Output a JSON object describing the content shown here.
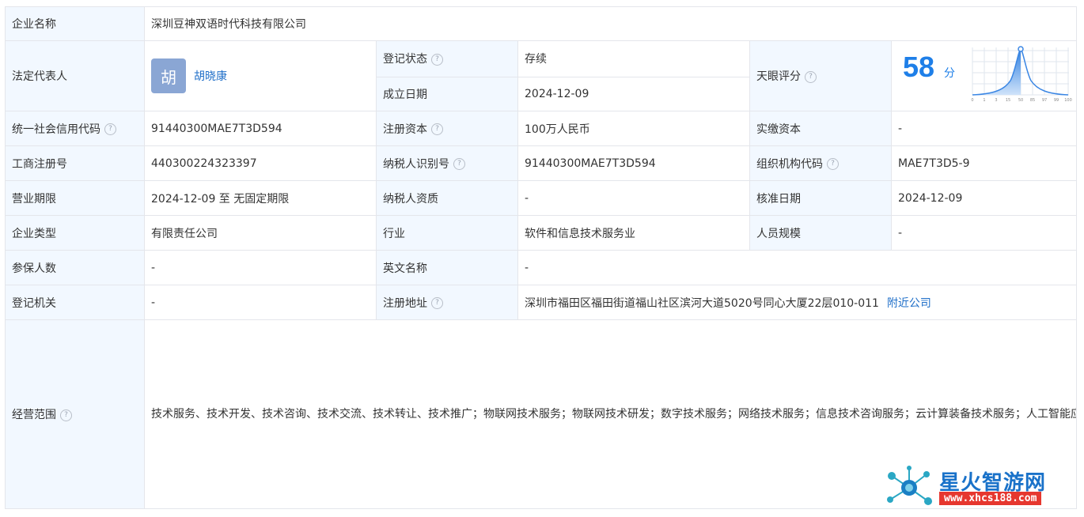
{
  "company": {
    "name_label": "企业名称",
    "name": "深圳豆神双语时代科技有限公司"
  },
  "legal_rep": {
    "label": "法定代表人",
    "avatar_char": "胡",
    "name": "胡晓康"
  },
  "reg_status": {
    "label": "登记状态",
    "value": "存续"
  },
  "established": {
    "label": "成立日期",
    "value": "2024-12-09"
  },
  "tianyan_score": {
    "label": "天眼评分",
    "value": "58",
    "unit": "分",
    "chart_axis": [
      "0",
      "1",
      "3",
      "15",
      "50",
      "85",
      "97",
      "99",
      "100"
    ]
  },
  "credit_code": {
    "label": "统一社会信用代码",
    "value": "91440300MAE7T3D594"
  },
  "reg_capital": {
    "label": "注册资本",
    "value": "100万人民币"
  },
  "paid_capital": {
    "label": "实缴资本",
    "value": "-"
  },
  "biz_reg_no": {
    "label": "工商注册号",
    "value": "440300224323397"
  },
  "taxpayer_id": {
    "label": "纳税人识别号",
    "value": "91440300MAE7T3D594"
  },
  "org_code": {
    "label": "组织机构代码",
    "value": "MAE7T3D5-9"
  },
  "biz_term": {
    "label": "营业期限",
    "value": "2024-12-09 至 无固定期限"
  },
  "taxpayer_qual": {
    "label": "纳税人资质",
    "value": "-"
  },
  "approval_date": {
    "label": "核准日期",
    "value": "2024-12-09"
  },
  "company_type": {
    "label": "企业类型",
    "value": "有限责任公司"
  },
  "industry": {
    "label": "行业",
    "value": "软件和信息技术服务业"
  },
  "staff_size": {
    "label": "人员规模",
    "value": "-"
  },
  "insured": {
    "label": "参保人数",
    "value": "-"
  },
  "english_name": {
    "label": "英文名称",
    "value": "-"
  },
  "reg_authority": {
    "label": "登记机关",
    "value": "-"
  },
  "reg_address": {
    "label": "注册地址",
    "value": "深圳市福田区福田街道福山社区滨河大道5020号同心大厦22层010-011",
    "nearby_link": "附近公司"
  },
  "biz_scope": {
    "label": "经营范围",
    "value": "技术服务、技术开发、技术咨询、技术交流、技术转让、技术推广；物联网技术服务；物联网技术研发；数字技术服务；网络技术服务；信息技术咨询服务；云计算装备技术服务；人工智能应用软件开发；人工智能基础资源与技术平台；5G通信技术服务；会议及展览服务；人工智能公共服务平台技术咨询服务；信息咨询服务（不含许可类信息咨询服务）；互联网数据服务；云计算设备制造；软件开发；数据处理服务；大数据服务；数字内容制作服务（不含出版发行）；计算机软硬件及辅助设备批发；数据处理和存储支持服务；人工智能公共数据平台；信息系统集成服务；日用百货销售；办公服务；数字创意产品展览展示服务；互联网销售（除销售需要许可的商品）；广告发布；数字广告设计、代理；数字广告制作；数字广告发布；广告设计、代理；互联网设备销售；文艺创作；组织文化艺术交流活动；文具用品批发；平面设计；单用途商业预付卡代理销售；电子产品销售；企业管理咨询；教育咨询服务（不含涉许可审批的教育培训活动）；人工智能行业应用系统集成服务；人工智能双创服务平台；旅游开发项目策划咨询；办公用品销售；人工智能基础软件开发；人工智能通用应用系统；人工智能硬件销售；人工智能理论与算法软件开发；智能机器人的研发；智能机器人销售；移动终端设备制造；智能控制系统集成；移动终端设备销售；计算机软硬件及辅助设备零售；计算机及办公设备维修；通信设备销售；计算机系统服务；通信设备制造；租赁服务（不含许可类租赁服务）；软件销售。（除依法须经批准的项目外，凭营业执照依法自主开展经营活动）"
  },
  "watermark": {
    "title": "星火智游网",
    "url": "www.xhcs188.com"
  },
  "colors": {
    "label_bg": "#f2f8ff",
    "border": "#e4e6eb",
    "link": "#1e6ec8",
    "status_green": "#2ea45a",
    "score_blue": "#1e7fe8"
  }
}
